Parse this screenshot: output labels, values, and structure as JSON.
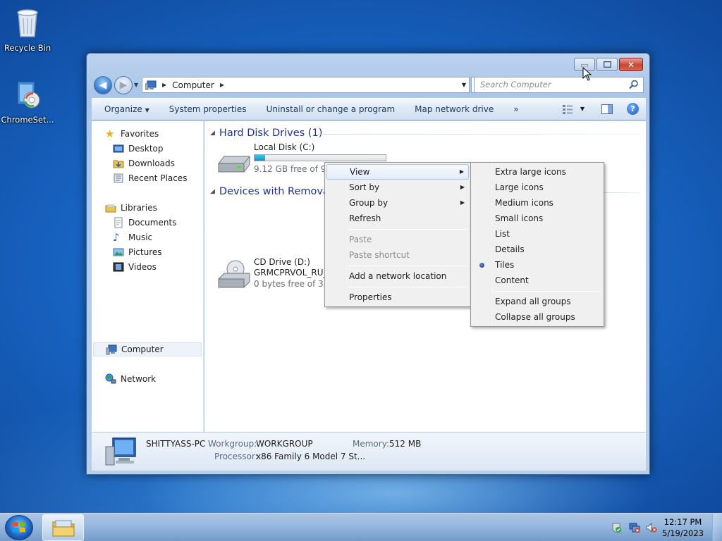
{
  "desktop": {
    "icons": [
      {
        "label": "Recycle Bin",
        "icon": "recycle-bin-icon"
      },
      {
        "label": "ChromeSet...",
        "icon": "chrome-setup-icon"
      }
    ]
  },
  "window": {
    "address": {
      "segments": [
        "Computer"
      ]
    },
    "search": {
      "placeholder": "Search Computer"
    },
    "toolbar": {
      "organize": "Organize",
      "system_properties": "System properties",
      "uninstall": "Uninstall or change a program",
      "map_network": "Map network drive",
      "more": "»"
    },
    "nav_pane": {
      "favorites": "Favorites",
      "desktop": "Desktop",
      "downloads": "Downloads",
      "recent_places": "Recent Places",
      "libraries": "Libraries",
      "documents": "Documents",
      "music": "Music",
      "pictures": "Pictures",
      "videos": "Videos",
      "computer": "Computer",
      "network": "Network"
    },
    "content": {
      "groups": [
        {
          "title": "Hard Disk Drives (1)",
          "items": [
            {
              "name": "Local Disk (C:)",
              "subtitle": "9.12 GB free of 9.89",
              "used_fraction": 0.08
            }
          ]
        },
        {
          "title": "Devices with Removab",
          "items": [
            {
              "name": "CD Drive (D:)",
              "label": "GRMCPRVOL_RU_D",
              "subtitle": "0 bytes free of 332"
            }
          ]
        }
      ]
    },
    "details": {
      "computer_name": "SHITTYASS-PC",
      "workgroup_label": "Workgroup:",
      "workgroup_value": "WORKGROUP",
      "memory_label": "Memory:",
      "memory_value": "512 MB",
      "processor_label": "Processor:",
      "processor_value": "x86 Family 6 Model 7 St..."
    }
  },
  "context_menu": {
    "items": {
      "view": "View",
      "sort_by": "Sort by",
      "group_by": "Group by",
      "refresh": "Refresh",
      "paste": "Paste",
      "paste_shortcut": "Paste shortcut",
      "add_network_location": "Add a network location",
      "properties": "Properties"
    }
  },
  "view_submenu": {
    "items": {
      "extra_large": "Extra large icons",
      "large": "Large icons",
      "medium": "Medium icons",
      "small": "Small icons",
      "list": "List",
      "details": "Details",
      "tiles": "Tiles",
      "content": "Content",
      "expand_all": "Expand all groups",
      "collapse_all": "Collapse all groups"
    },
    "selected": "Tiles"
  },
  "taskbar": {
    "time": "12:17 PM",
    "date": "5/19/2023"
  },
  "colors": {
    "group_title": "#1e3287",
    "drive_fill": "#1a95c4",
    "close_button": "#c8452f"
  }
}
